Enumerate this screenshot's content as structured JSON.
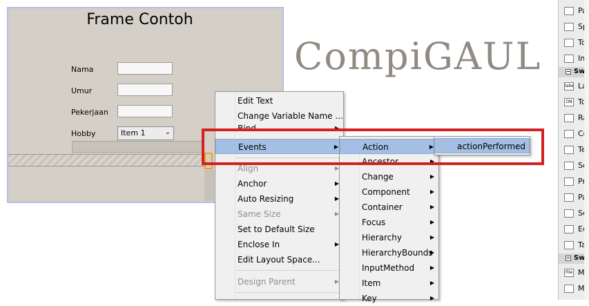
{
  "frame": {
    "title": "Frame Contoh",
    "fields": [
      {
        "label": "Nama",
        "value": ""
      },
      {
        "label": "Umur",
        "value": ""
      },
      {
        "label": "Pekerjaan",
        "value": ""
      }
    ],
    "hobby": {
      "label": "Hobby",
      "selected": "Item 1"
    }
  },
  "watermark": "CompiGAUL",
  "context_menu": {
    "items": [
      {
        "label": "Edit Text",
        "submenu": false,
        "disabled": false
      },
      {
        "label": "Change Variable Name ...",
        "submenu": false,
        "disabled": false
      },
      {
        "label": "Bind",
        "submenu": true,
        "disabled": false
      },
      {
        "label": "Events",
        "submenu": true,
        "disabled": false,
        "selected": true
      },
      {
        "label": "Align",
        "submenu": true,
        "disabled": true
      },
      {
        "label": "Anchor",
        "submenu": true,
        "disabled": false
      },
      {
        "label": "Auto Resizing",
        "submenu": true,
        "disabled": false
      },
      {
        "label": "Same Size",
        "submenu": true,
        "disabled": true
      },
      {
        "label": "Set to Default Size",
        "submenu": false,
        "disabled": false
      },
      {
        "label": "Enclose In",
        "submenu": true,
        "disabled": false
      },
      {
        "label": "Edit Layout Space...",
        "submenu": false,
        "disabled": false
      },
      {
        "label": "Design Parent",
        "submenu": true,
        "disabled": true
      }
    ]
  },
  "events_menu": {
    "items": [
      {
        "label": "Action",
        "selected": true
      },
      {
        "label": "Ancestor"
      },
      {
        "label": "Change"
      },
      {
        "label": "Component"
      },
      {
        "label": "Container"
      },
      {
        "label": "Focus"
      },
      {
        "label": "Hierarchy"
      },
      {
        "label": "HierarchyBounds"
      },
      {
        "label": "InputMethod"
      },
      {
        "label": "Item"
      },
      {
        "label": "Key"
      }
    ]
  },
  "action_menu": {
    "items": [
      {
        "label": "actionPerformed",
        "selected": true
      }
    ]
  },
  "palette": {
    "items": [
      {
        "label": "Pan",
        "icon": "panel-icon"
      },
      {
        "label": "Spli",
        "icon": "split-pane-icon"
      },
      {
        "label": "Too",
        "icon": "toolbar-icon"
      },
      {
        "label": "Inte",
        "icon": "internal-frame-icon"
      },
      {
        "category": "Swi"
      },
      {
        "label": "Lab",
        "icon": "label-icon",
        "glyph": "label"
      },
      {
        "label": "Tog",
        "icon": "toggle-button-icon",
        "glyph": "ON"
      },
      {
        "label": "Rad",
        "icon": "radio-button-icon"
      },
      {
        "label": "Con",
        "icon": "combo-box-icon"
      },
      {
        "label": "Tex",
        "icon": "text-field-icon"
      },
      {
        "label": "Scro",
        "icon": "scrollbar-icon"
      },
      {
        "label": "Pro",
        "icon": "progress-bar-icon"
      },
      {
        "label": "Pas",
        "icon": "password-field-icon"
      },
      {
        "label": "Sep",
        "icon": "separator-icon"
      },
      {
        "label": "Edit",
        "icon": "editor-pane-icon"
      },
      {
        "label": "Tab",
        "icon": "table-icon"
      },
      {
        "category": "Swi"
      },
      {
        "label": "Mer",
        "icon": "menu-bar-icon",
        "glyph": "File"
      },
      {
        "label": "Mer",
        "icon": "menu-icon"
      }
    ]
  },
  "colors": {
    "form_bg": "#d4d0c8",
    "menu_selected": "#a4bfe4",
    "highlight_red": "#d42020",
    "selection_orange": "#e6a417"
  }
}
